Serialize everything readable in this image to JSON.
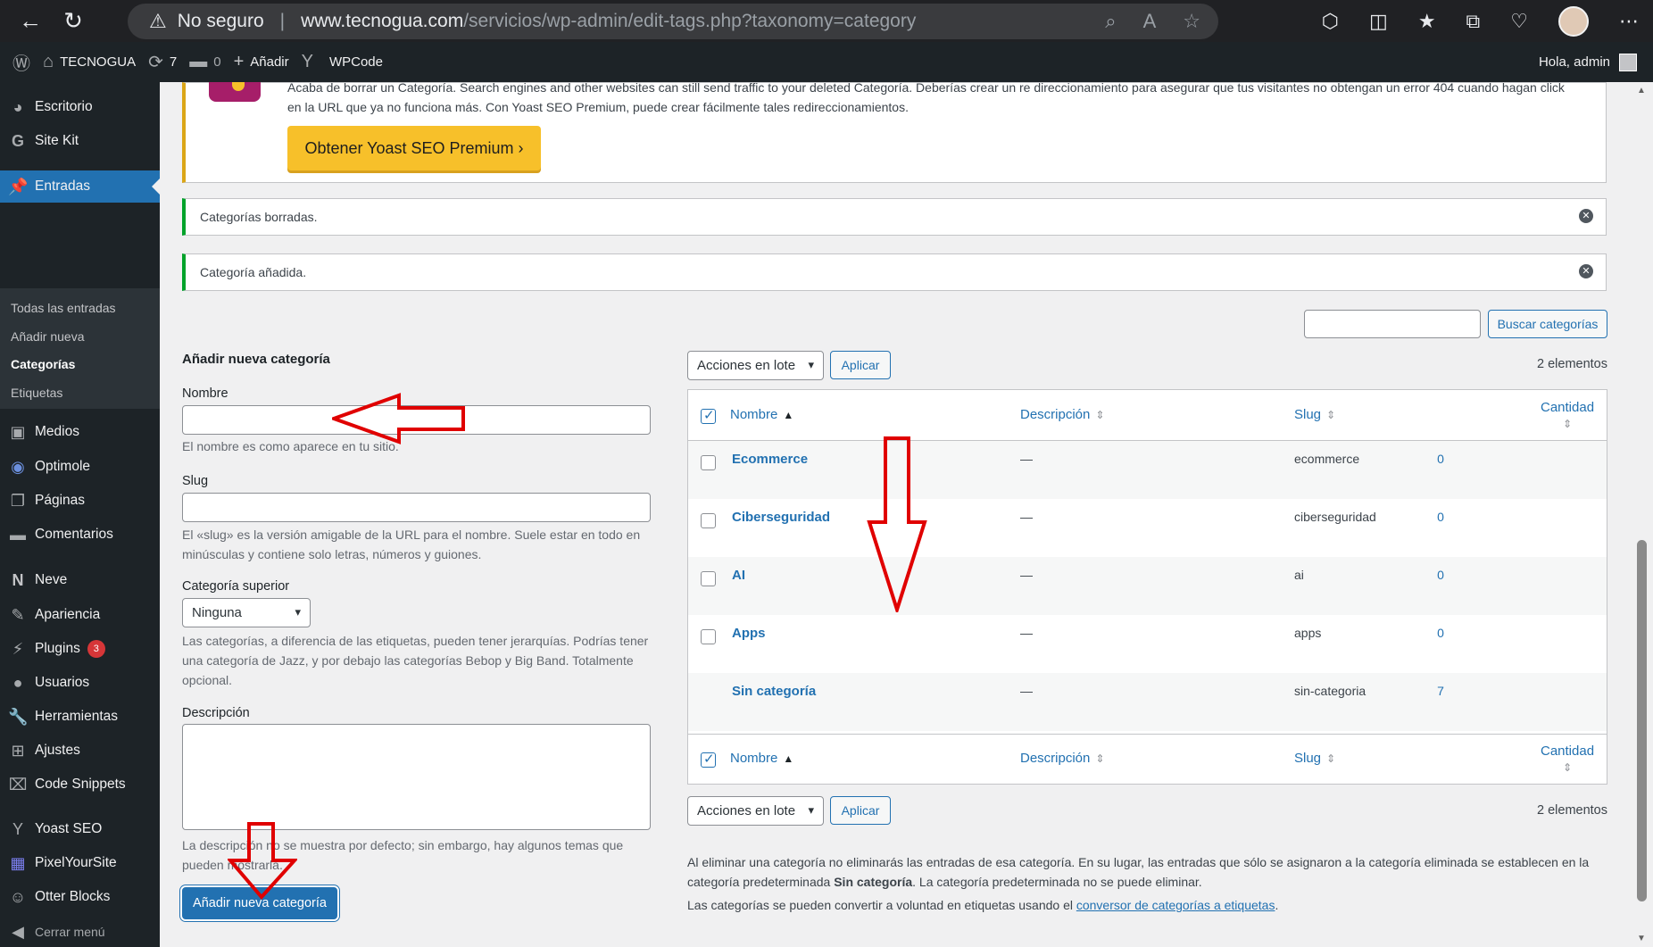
{
  "browser": {
    "security_label": "No seguro",
    "url_host": "www.tecnogua.com",
    "url_path": "/servicios/wp-admin/edit-tags.php?taxonomy=category"
  },
  "adminbar": {
    "site_name": "TECNOGUA",
    "updates_count": "7",
    "comments_count": "0",
    "add_label": "Añadir",
    "wpcode_label": "WPCode",
    "greeting": "Hola, admin"
  },
  "sidebar": {
    "items": [
      {
        "label": "Escritorio",
        "icon": "dashboard-icon"
      },
      {
        "label": "Site Kit",
        "icon": "google-icon"
      },
      {
        "label": "Entradas",
        "icon": "pin-icon"
      },
      {
        "label": "Medios",
        "icon": "media-icon"
      },
      {
        "label": "Optimole",
        "icon": "optimole-icon"
      },
      {
        "label": "Páginas",
        "icon": "pages-icon"
      },
      {
        "label": "Comentarios",
        "icon": "comments-icon"
      },
      {
        "label": "Neve",
        "icon": "neve-icon"
      },
      {
        "label": "Apariencia",
        "icon": "brush-icon"
      },
      {
        "label": "Plugins",
        "icon": "plugin-icon",
        "badge": "3"
      },
      {
        "label": "Usuarios",
        "icon": "users-icon"
      },
      {
        "label": "Herramientas",
        "icon": "tools-icon"
      },
      {
        "label": "Ajustes",
        "icon": "settings-icon"
      },
      {
        "label": "Code Snippets",
        "icon": "code-icon"
      },
      {
        "label": "Yoast SEO",
        "icon": "yoast-icon"
      },
      {
        "label": "PixelYourSite",
        "icon": "pixel-icon"
      },
      {
        "label": "Otter Blocks",
        "icon": "otter-icon"
      },
      {
        "label": "Cerrar menú",
        "icon": "collapse-icon"
      }
    ],
    "submenu": [
      "Todas las entradas",
      "Añadir nueva",
      "Categorías",
      "Etiquetas"
    ]
  },
  "notices": {
    "yoast_text": "Acaba de borrar un Categoría. Search engines and other websites can still send traffic to your deleted Categoría. Deberías crear un re direccionamiento para asegurar que tus visitantes no obtengan un error 404 cuando hagan click en la URL que ya no funciona más. Con Yoast SEO Premium, puede crear fácilmente tales redireccionamientos.",
    "yoast_button": "Obtener Yoast SEO Premium ›",
    "deleted": "Categorías borradas.",
    "added": "Categoría añadida."
  },
  "form": {
    "title": "Añadir nueva categoría",
    "name_label": "Nombre",
    "name_help": "El nombre es como aparece en tu sitio.",
    "slug_label": "Slug",
    "slug_help": "El «slug» es la versión amigable de la URL para el nombre. Suele estar en todo en minúsculas y contiene solo letras, números y guiones.",
    "parent_label": "Categoría superior",
    "parent_value": "Ninguna",
    "parent_help": "Las categorías, a diferencia de las etiquetas, pueden tener jerarquías. Podrías tener una categoría de Jazz, y por debajo las categorías Bebop y Big Band. Totalmente opcional.",
    "desc_label": "Descripción",
    "desc_help": "La descripción no se muestra por defecto; sin embargo, hay algunos temas que pueden mostrarla.",
    "submit": "Añadir nueva categoría"
  },
  "list": {
    "search_button": "Buscar categorías",
    "bulk_label": "Acciones en lote",
    "apply_label": "Aplicar",
    "count_label": "2 elementos",
    "columns": {
      "name": "Nombre",
      "description": "Descripción",
      "slug": "Slug",
      "count": "Cantidad"
    },
    "rows": [
      {
        "name": "Ecommerce",
        "description": "—",
        "slug": "ecommerce",
        "count": "0"
      },
      {
        "name": "Ciberseguridad",
        "description": "—",
        "slug": "ciberseguridad",
        "count": "0"
      },
      {
        "name": "AI",
        "description": "—",
        "slug": "ai",
        "count": "0"
      },
      {
        "name": "Apps",
        "description": "—",
        "slug": "apps",
        "count": "0"
      },
      {
        "name": "Sin categoría",
        "description": "—",
        "slug": "sin-categoria",
        "count": "7"
      }
    ],
    "note1_a": "Al eliminar una categoría no eliminarás las entradas de esa categoría. En su lugar, las entradas que sólo se asignaron a la categoría eliminada se establecen en la categoría predeterminada ",
    "note1_b": "Sin categoría",
    "note1_c": ". La categoría predeterminada no se puede eliminar.",
    "note2_a": "Las categorías se pueden convertir a voluntad en etiquetas usando el ",
    "note2_link": "conversor de categorías a etiquetas",
    "note2_b": "."
  },
  "colors": {
    "accent": "#2271b1",
    "sidebar_bg": "#1d2327",
    "annotation": "#e00000",
    "yoast": "#f7c02a"
  }
}
